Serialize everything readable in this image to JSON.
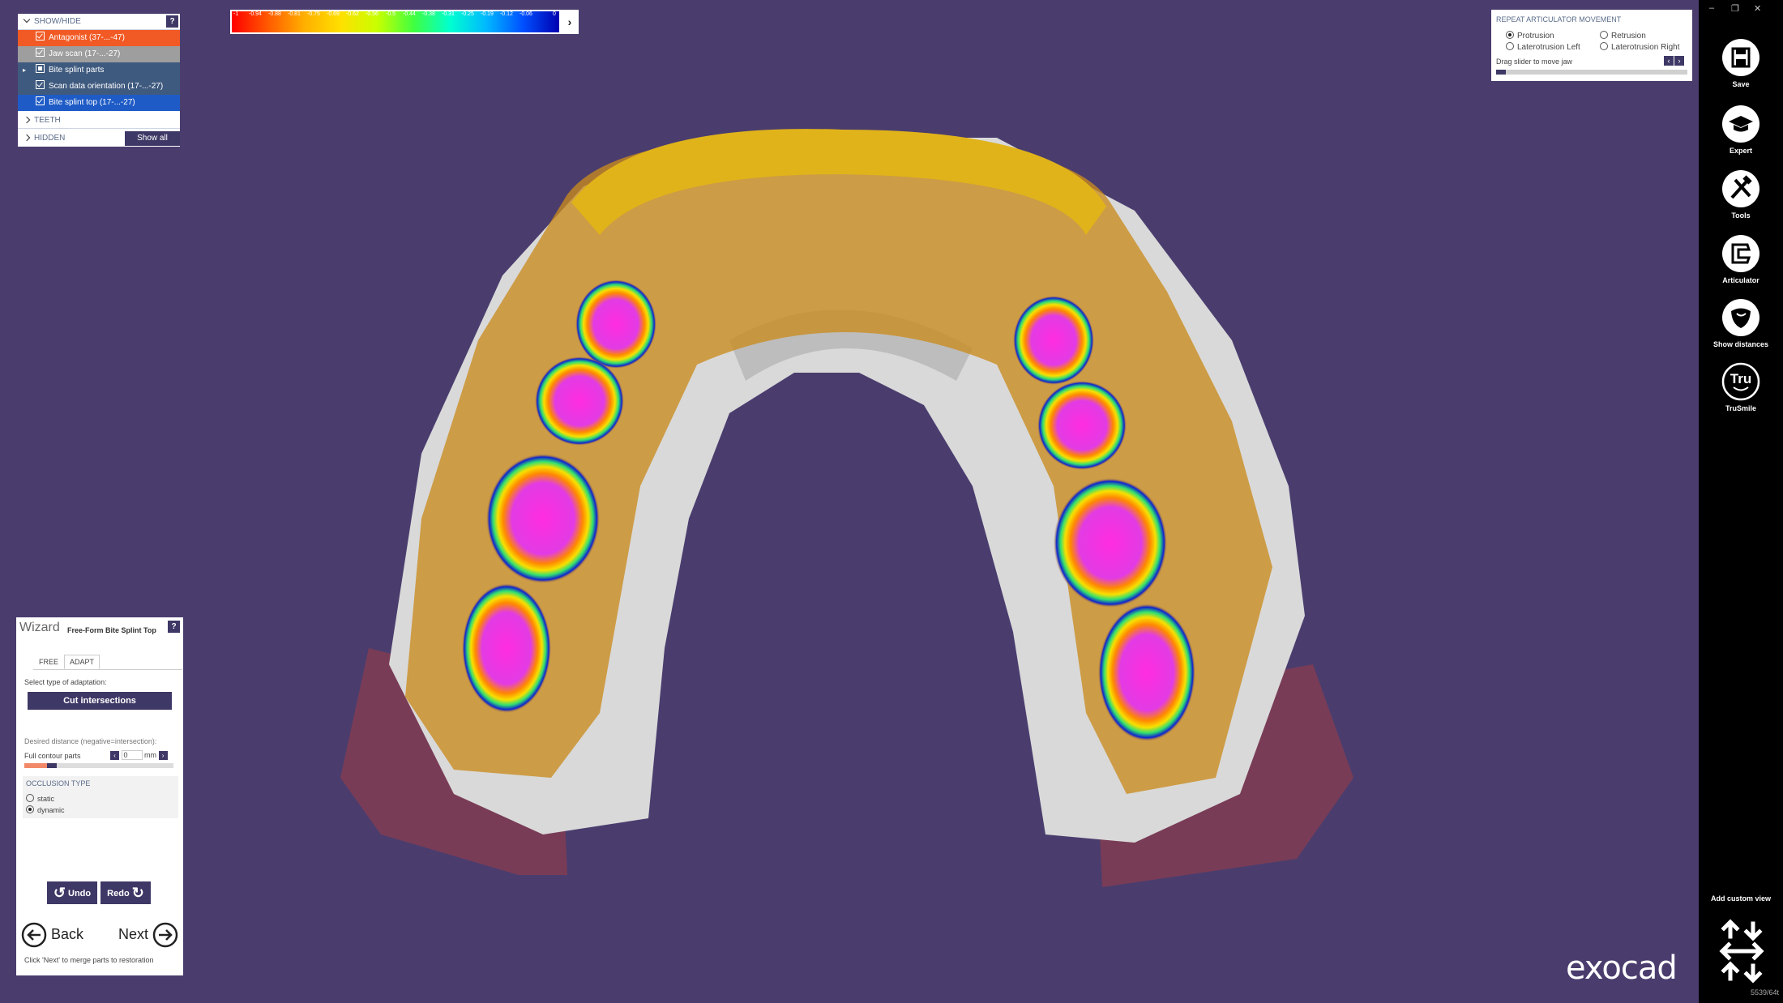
{
  "show_hide": {
    "title": "SHOW/HIDE",
    "help": "?",
    "items": [
      {
        "label": "Antagonist (37-...-47)",
        "color": "#f15a24"
      },
      {
        "label": "Jaw scan (17-...-27)",
        "color": "#9e9e9e"
      },
      {
        "label": "Bite splint parts",
        "color": "#3f5a7f"
      },
      {
        "label": "Scan data orientation (17-...-27)",
        "color": "#3f5a7f"
      },
      {
        "label": "Bite splint top (17-...-27)",
        "color": "#1e5bc6"
      }
    ],
    "teeth_label": "TEETH",
    "hidden_label": "HIDDEN",
    "show_all": "Show all"
  },
  "color_scale": {
    "ticks": [
      "-1",
      "-0.94",
      "-0.88",
      "-0.81",
      "-0.75",
      "-0.69",
      "-0.62",
      "-0.56",
      "-0.5",
      "-0.44",
      "-0.38",
      "-0.31",
      "-0.25",
      "-0.19",
      "-0.12",
      "-0.06",
      "0"
    ],
    "arrow": "›"
  },
  "articulator": {
    "title": "REPEAT ARTICULATOR MOVEMENT",
    "options": [
      "Protrusion",
      "Retrusion",
      "Laterotrusion Left",
      "Laterotrusion Right"
    ],
    "selected": "Protrusion",
    "slider_label": "Drag slider to move jaw",
    "slider_value": 0.05
  },
  "toolbar": {
    "minimize": "–",
    "restore": "❐",
    "close": "✕",
    "tools": [
      {
        "label": "Save",
        "icon": "save-icon"
      },
      {
        "label": "Expert",
        "icon": "graduation-cap-icon"
      },
      {
        "label": "Tools",
        "icon": "hammer-wrench-icon"
      },
      {
        "label": "Articulator",
        "icon": "articulator-icon"
      },
      {
        "label": "Show distances",
        "icon": "tooth-distance-icon"
      },
      {
        "label": "TruSmile",
        "icon": "trusmile-icon",
        "icon_text": "Tru"
      }
    ],
    "custom_view": "Add custom view"
  },
  "wizard": {
    "title": "Wizard",
    "subtitle": "Free-Form Bite Splint Top",
    "help": "?",
    "tabs": [
      "FREE",
      "ADAPT"
    ],
    "active_tab": "ADAPT",
    "select_label": "Select type of adaptation:",
    "cut_button": "Cut intersections",
    "distance_label": "Desired distance (negative=intersection):",
    "parts_label": "Full contour parts",
    "distance_value": "0",
    "unit": "mm",
    "occlusion_title": "OCCLUSION TYPE",
    "occlusion_options": [
      "static",
      "dynamic"
    ],
    "occlusion_selected": "dynamic",
    "undo": "Undo",
    "redo": "Redo",
    "back": "Back",
    "next": "Next",
    "hint": "Click 'Next' to merge parts to restoration"
  },
  "logo": "exocad",
  "build": "5539/64t"
}
